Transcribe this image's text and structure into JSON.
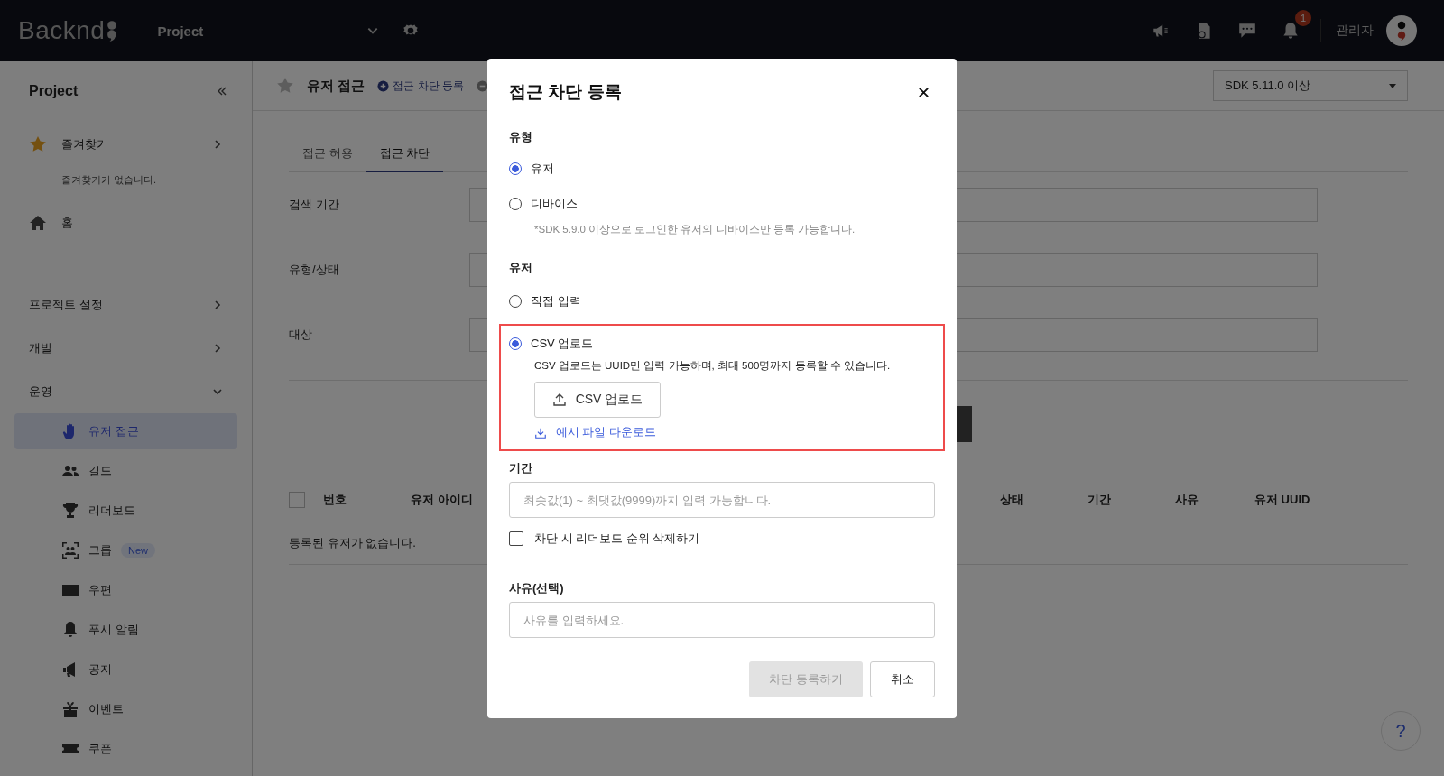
{
  "header": {
    "logo": "Backnd",
    "project": "Project",
    "notification_count": "1",
    "user": "관리자"
  },
  "sidebar": {
    "title": "Project",
    "favorites": {
      "label": "즐겨찾기",
      "empty_note": "즐겨찾기가 없습니다."
    },
    "home": "홈",
    "sections": [
      {
        "label": "프로젝트 설정",
        "expanded": false
      },
      {
        "label": "개발",
        "expanded": false
      },
      {
        "label": "운영",
        "expanded": true,
        "children": [
          {
            "label": "유저 접근",
            "selected": true
          },
          {
            "label": "길드",
            "selected": false
          },
          {
            "label": "리더보드",
            "selected": false
          },
          {
            "label": "그룹",
            "selected": false,
            "badge": "New"
          },
          {
            "label": "우편",
            "selected": false
          },
          {
            "label": "푸시 알림",
            "selected": false
          },
          {
            "label": "공지",
            "selected": false
          },
          {
            "label": "이벤트",
            "selected": false
          },
          {
            "label": "쿠폰",
            "selected": false
          }
        ]
      }
    ]
  },
  "main": {
    "title": "유저 접근",
    "actions": [
      "접근 차단 등록"
    ],
    "sdk_select": "SDK 5.11.0 이상",
    "tabs": [
      {
        "label": "접근 허용",
        "selected": false
      },
      {
        "label": "접근 차단",
        "selected": true
      }
    ],
    "filters": [
      "검색 기간",
      "유형/상태",
      "대상"
    ],
    "table": {
      "select_all_checked": false,
      "columns": [
        "번호",
        "유저 아이디",
        "상태",
        "기간",
        "사유",
        "유저 UUID"
      ],
      "empty": "등록된 유저가 없습니다."
    },
    "help": "?"
  },
  "modal": {
    "title": "접근 차단 등록",
    "type": {
      "label": "유형",
      "options": [
        {
          "label": "유저",
          "selected": true
        },
        {
          "label": "디바이스",
          "selected": false
        }
      ],
      "note": "*SDK 5.9.0 이상으로 로그인한 유저의 디바이스만 등록 가능합니다."
    },
    "user": {
      "label": "유저",
      "options": [
        {
          "label": "직접 입력",
          "selected": false,
          "highlighted": false
        },
        {
          "label": "CSV 업로드",
          "selected": true,
          "highlighted": true
        }
      ],
      "csv_note": "CSV 업로드는 UUID만 입력 가능하며, 최대 500명까지 등록할 수 있습니다.",
      "upload_button": "CSV 업로드",
      "sample_link": "예시 파일 다운로드"
    },
    "period": {
      "label": "기간",
      "placeholder": "최솟값(1) ~ 최댓값(9999)까지 입력 가능합니다."
    },
    "delete_ranking": {
      "label": "차단 시 리더보드 순위 삭제하기",
      "checked": false
    },
    "reason": {
      "label": "사유(선택)",
      "placeholder": "사유를 입력하세요."
    },
    "buttons": [
      {
        "label": "차단 등록하기",
        "disabled": true
      },
      {
        "label": "취소",
        "disabled": false
      }
    ]
  }
}
